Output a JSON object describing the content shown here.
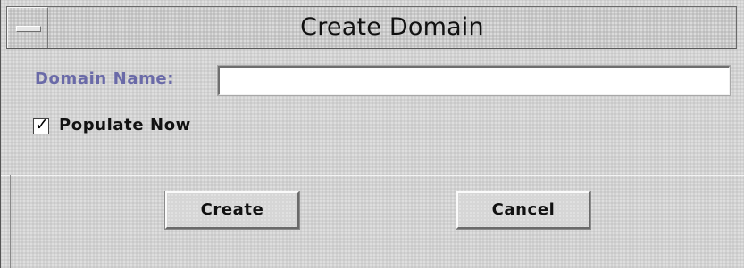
{
  "window": {
    "title": "Create Domain"
  },
  "form": {
    "domain_name_label": "Domain Name:",
    "domain_name_value": "",
    "populate_now_label": "Populate Now",
    "populate_now_checked": true
  },
  "buttons": {
    "create_label": "Create",
    "cancel_label": "Cancel"
  },
  "colors": {
    "label_accent": "#6a6aa8",
    "background": "#d2d2d2"
  }
}
